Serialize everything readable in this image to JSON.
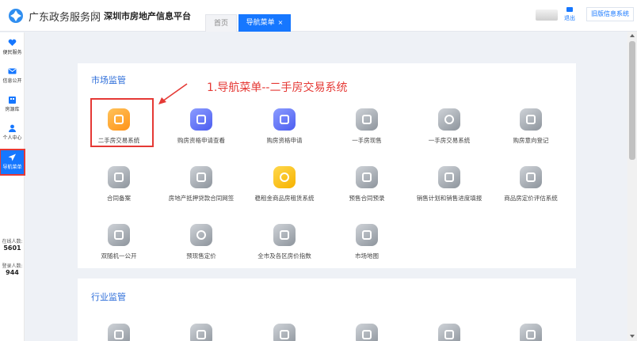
{
  "header": {
    "gov_title": "广东政务服务网",
    "platform_title": "深圳市房地产信息平台",
    "tabs": [
      {
        "label": "首页"
      },
      {
        "label": "导航菜单",
        "close": "×"
      }
    ],
    "logout_label": "退出",
    "old_system_label": "旧版信息系统"
  },
  "sidebar": {
    "items": [
      {
        "label": "便民服务",
        "icon": "heart-icon"
      },
      {
        "label": "信息公开",
        "icon": "mail-icon"
      },
      {
        "label": "房源库",
        "icon": "building-icon"
      },
      {
        "label": "个人中心",
        "icon": "user-icon"
      },
      {
        "label": "导航菜单",
        "icon": "paper-plane-icon",
        "active": true
      }
    ],
    "stats": [
      {
        "label": "在线人数:",
        "value": "5601"
      },
      {
        "label": "登录人数:",
        "value": "944"
      }
    ]
  },
  "market": {
    "title": "市场监管",
    "items": [
      {
        "label": "二手房交易系统",
        "color": "orange",
        "icon": "house-hand-icon"
      },
      {
        "label": "购房资格申请查看",
        "color": "purple",
        "icon": "layers-icon"
      },
      {
        "label": "购房资格申请",
        "color": "purple",
        "icon": "layers-icon"
      },
      {
        "label": "一手房现售",
        "color": "gray",
        "icon": "building-icon"
      },
      {
        "label": "一手房交易系统",
        "color": "gray",
        "icon": "currency-icon"
      },
      {
        "label": "购房意向登记",
        "color": "gray",
        "icon": "document-icon"
      },
      {
        "label": "合同备案",
        "color": "gray",
        "icon": "pen-icon"
      },
      {
        "label": "房地产抵押贷款合同网签",
        "color": "gray",
        "icon": "contract-icon"
      },
      {
        "label": "稳租金商品房租赁系统",
        "color": "yellow",
        "icon": "check-circle-icon"
      },
      {
        "label": "预售合同预录",
        "color": "gray",
        "icon": "form-icon"
      },
      {
        "label": "销售计划和销售进度填报",
        "color": "gray",
        "icon": "report-icon"
      },
      {
        "label": "商品房定价评估系统",
        "color": "gray",
        "icon": "price-icon"
      },
      {
        "label": "双随机一公开",
        "color": "gray",
        "icon": "shuffle-icon"
      },
      {
        "label": "预现售定价",
        "color": "gray",
        "icon": "currency-icon"
      },
      {
        "label": "全市及各区房价指数",
        "color": "gray",
        "icon": "chart-box-icon"
      },
      {
        "label": "市场地图",
        "color": "gray",
        "icon": "shield-icon"
      }
    ]
  },
  "industry": {
    "title": "行业监管",
    "items": [
      {
        "icon": "building-icon"
      },
      {
        "icon": "document-icon"
      },
      {
        "icon": "form-icon"
      },
      {
        "icon": "report-icon"
      },
      {
        "icon": "clipboard-icon"
      },
      {
        "icon": "building-icon"
      }
    ]
  },
  "annotation": "1.导航菜单--二手房交易系统",
  "colors": {
    "accent": "#1677ff",
    "highlight": "#e53935",
    "title": "#2b6cd9"
  }
}
